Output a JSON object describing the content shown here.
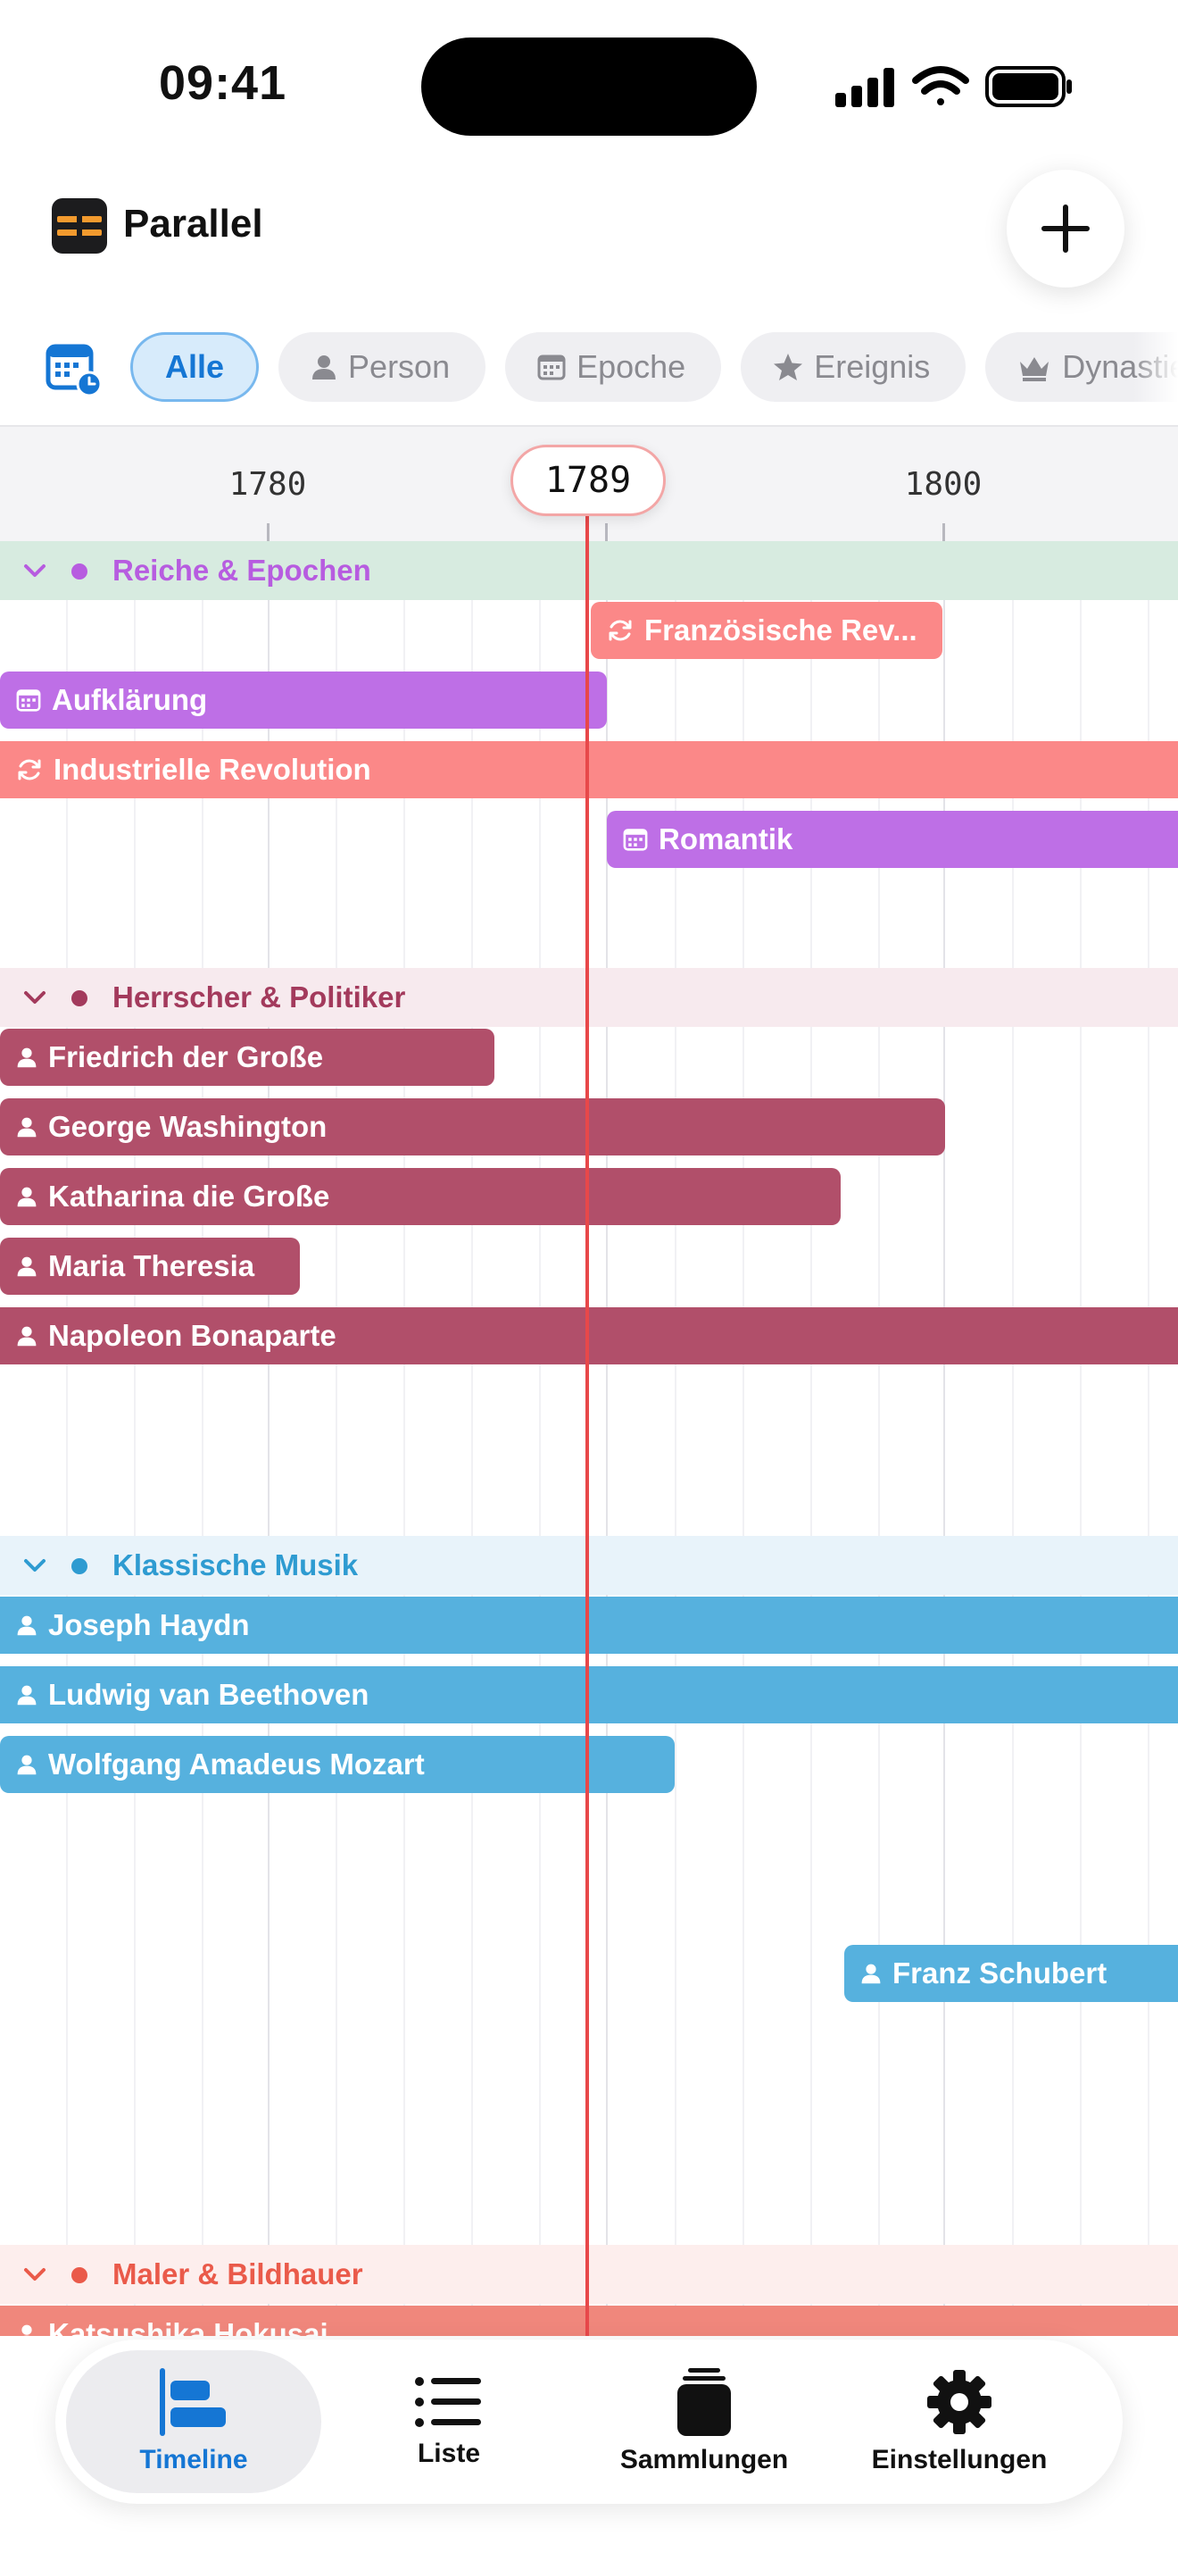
{
  "status_bar": {
    "time": "09:41"
  },
  "header": {
    "title": "Parallel"
  },
  "filters": [
    {
      "label": "Alle",
      "icon": "none",
      "active": true
    },
    {
      "label": "Person",
      "icon": "person-icon",
      "active": false
    },
    {
      "label": "Epoche",
      "icon": "calendar-icon",
      "active": false
    },
    {
      "label": "Ereignis",
      "icon": "star-icon",
      "active": false
    },
    {
      "label": "Dynastie",
      "icon": "crown-icon",
      "active": false
    }
  ],
  "timeline": {
    "ticks": [
      "1780",
      "1800"
    ],
    "current_year": "1789",
    "sections": [
      {
        "title": "Reiche & Epochen",
        "color": "#b75ce0",
        "header_bg": "#d7ebe0",
        "items": [
          {
            "label": "Französische Rev...",
            "type": "event",
            "color": "#fb8888"
          },
          {
            "label": "Aufklärung",
            "type": "epoch",
            "color": "#be6fe6"
          },
          {
            "label": "Industrielle Revolution",
            "type": "event",
            "color": "#fb8888"
          },
          {
            "label": "Romantik",
            "type": "epoch",
            "color": "#be6fe6"
          }
        ]
      },
      {
        "title": "Herrscher & Politiker",
        "color": "#a33a5c",
        "header_bg": "#f7eaee",
        "items": [
          {
            "label": "Friedrich der Große",
            "type": "person",
            "color": "#b14f6a"
          },
          {
            "label": "George Washington",
            "type": "person",
            "color": "#b14f6a"
          },
          {
            "label": "Katharina die Große",
            "type": "person",
            "color": "#b14f6a"
          },
          {
            "label": "Maria Theresia",
            "type": "person",
            "color": "#b14f6a"
          },
          {
            "label": "Napoleon Bonaparte",
            "type": "person",
            "color": "#b14f6a"
          }
        ]
      },
      {
        "title": "Klassische Musik",
        "color": "#2e9bd1",
        "header_bg": "#e8f3fa",
        "items": [
          {
            "label": "Joseph Haydn",
            "type": "person",
            "color": "#56b1de"
          },
          {
            "label": "Ludwig van Beethoven",
            "type": "person",
            "color": "#56b1de"
          },
          {
            "label": "Wolfgang Amadeus Mozart",
            "type": "person",
            "color": "#56b1de"
          },
          {
            "label": "Franz Schubert",
            "type": "person",
            "color": "#56b1de"
          }
        ]
      },
      {
        "title": "Maler & Bildhauer",
        "color": "#ea5a4a",
        "header_bg": "#fdeeed",
        "items": [
          {
            "label": "Katsushika Hokusai",
            "type": "person",
            "color": "#f0877c"
          }
        ]
      }
    ]
  },
  "tabs": [
    {
      "label": "Timeline",
      "icon": "timeline-icon",
      "active": true
    },
    {
      "label": "Liste",
      "icon": "list-icon",
      "active": false
    },
    {
      "label": "Sammlungen",
      "icon": "collections-icon",
      "active": false
    },
    {
      "label": "Einstellungen",
      "icon": "gear-icon",
      "active": false
    }
  ],
  "colors": {
    "accent": "#1576d4",
    "now_line": "#e8484a"
  }
}
